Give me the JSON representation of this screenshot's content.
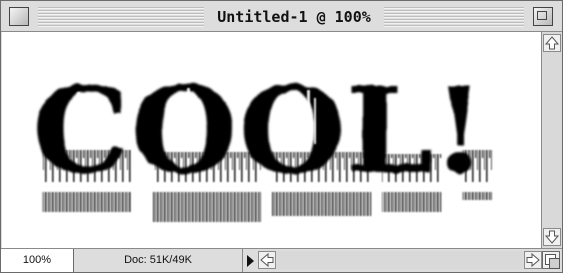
{
  "window": {
    "title": "Untitled-1 @ 100%"
  },
  "canvas": {
    "artwork_text": "COOL!",
    "artwork_color": "#000000",
    "background_color": "#ffffff"
  },
  "status": {
    "zoom_level": "100%",
    "doc_info": "Doc: 51K/49K"
  },
  "icons": {
    "close": "close-box-icon",
    "zoom": "zoom-box-icon",
    "scroll_up": "arrow-up-icon",
    "scroll_down": "arrow-down-icon",
    "scroll_left": "arrow-left-icon",
    "scroll_right": "arrow-right-icon",
    "status_menu": "triangle-right-icon",
    "grow": "size-box-icon"
  }
}
